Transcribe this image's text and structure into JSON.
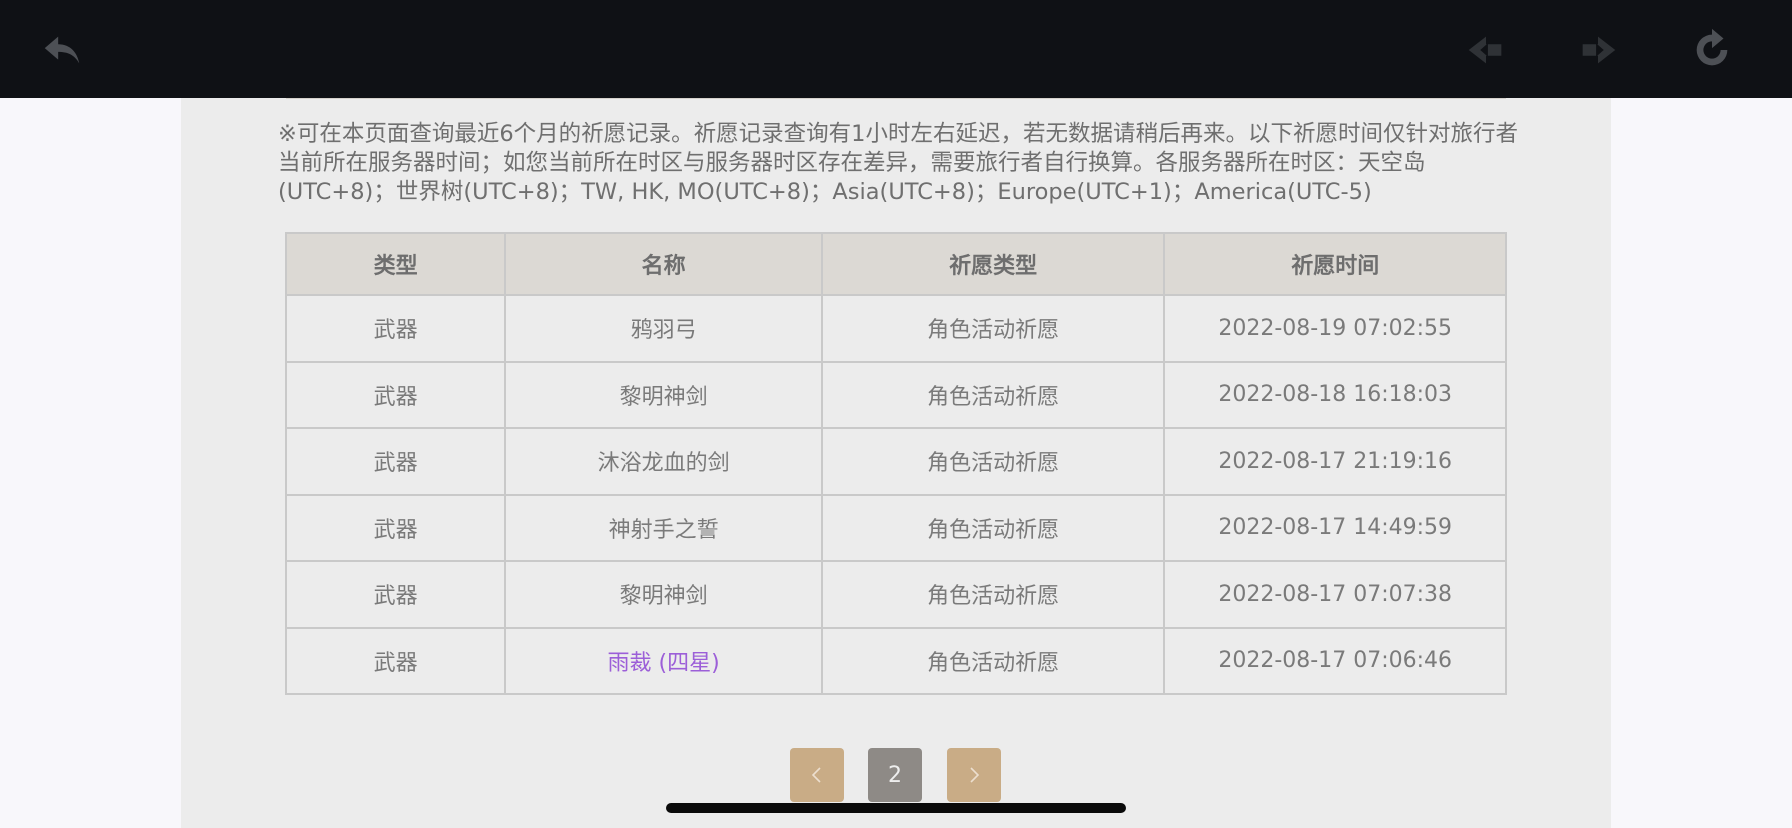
{
  "toolbar": {
    "back_icon": "back-arrow-icon",
    "prev_icon": "prev-page-icon",
    "next_icon": "next-page-icon",
    "refresh_icon": "refresh-icon"
  },
  "notice": "※可在本页面查询最近6个月的祈愿记录。祈愿记录查询有1小时左右延迟，若无数据请稍后再来。以下祈愿时间仅针对旅行者当前所在服务器时间；如您当前所在时区与服务器时区存在差异，需要旅行者自行换算。各服务器所在时区：天空岛(UTC+8)；世界树(UTC+8)；TW, HK, MO(UTC+8)；Asia(UTC+8)；Europe(UTC+1)；America(UTC-5)",
  "table": {
    "headers": [
      "类型",
      "名称",
      "祈愿类型",
      "祈愿时间"
    ],
    "rows": [
      [
        "武器",
        "鸦羽弓",
        "角色活动祈愿",
        "2022-08-19 07:02:55"
      ],
      [
        "武器",
        "黎明神剑",
        "角色活动祈愿",
        "2022-08-18 16:18:03"
      ],
      [
        "武器",
        "沐浴龙血的剑",
        "角色活动祈愿",
        "2022-08-17 21:19:16"
      ],
      [
        "武器",
        "神射手之誓",
        "角色活动祈愿",
        "2022-08-17 14:49:59"
      ],
      [
        "武器",
        "黎明神剑",
        "角色活动祈愿",
        "2022-08-17 07:07:38"
      ],
      [
        "武器",
        "雨裁 (四星)",
        "角色活动祈愿",
        "2022-08-17 07:06:46"
      ]
    ]
  },
  "colors": {
    "four_star": "#9c5fd8",
    "pager_accent": "#c9ac86"
  },
  "pagination": {
    "current_page": "2"
  }
}
